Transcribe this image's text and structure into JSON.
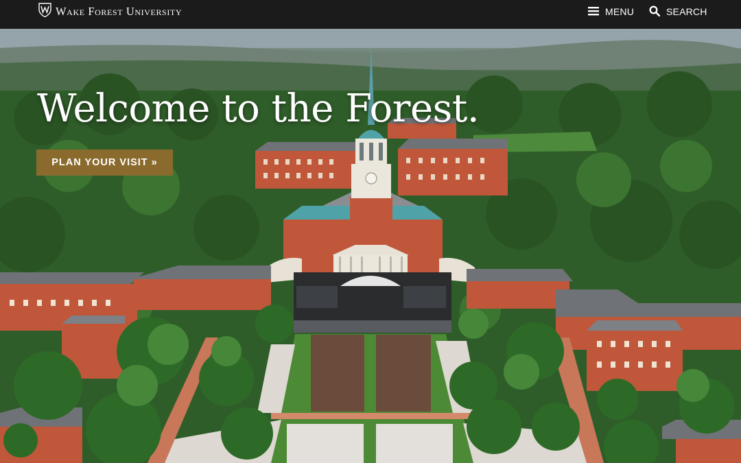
{
  "header": {
    "brand_name": "Wake Forest University",
    "logo_icon": "shield-logo-icon",
    "menu_label": "MENU",
    "menu_icon": "hamburger-icon",
    "search_label": "SEARCH",
    "search_icon": "magnifier-icon"
  },
  "hero": {
    "title": "Welcome to the Forest.",
    "cta_label": "PLAN YOUR VISIT »",
    "image_subject": "aerial-campus-photo"
  },
  "colors": {
    "topbar_bg": "#1b1b1b",
    "cta_bg": "#8b6b2d",
    "text": "#ffffff",
    "brick": "#c0573a",
    "roof": "#6f7276",
    "copper": "#4fa3a8",
    "foliage": "#2f5a2a"
  }
}
